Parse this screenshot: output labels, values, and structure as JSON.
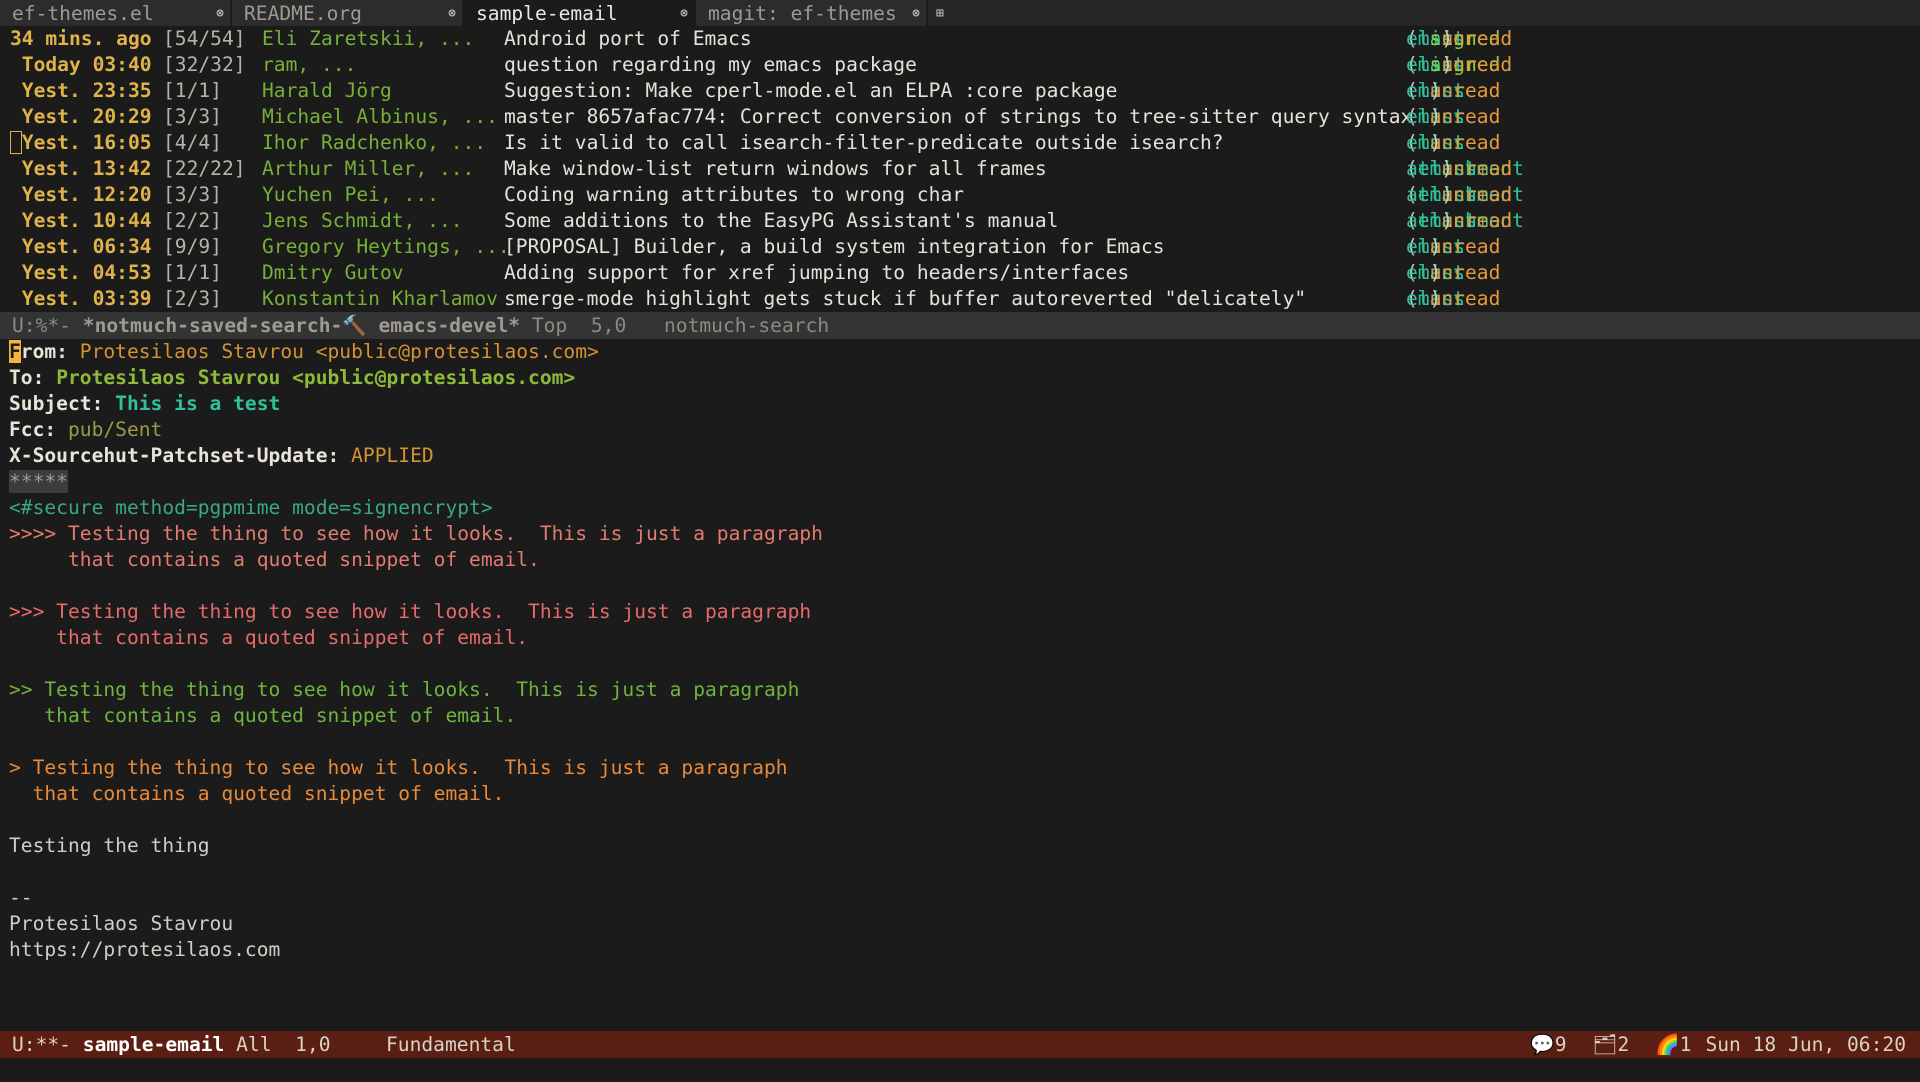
{
  "tabs": [
    {
      "label": "ef-themes.el",
      "active": false
    },
    {
      "label": "README.org",
      "active": false
    },
    {
      "label": "sample-email",
      "active": true
    },
    {
      "label": "magit: ef-themes",
      "active": false
    }
  ],
  "tab_close_glyph": "⊗",
  "tab_add_glyph": "⊞",
  "search_results": [
    {
      "date": "34 mins. ago",
      "count": "[54/54]",
      "authors": "Eli Zaretskii, ...",
      "subject": "Android port of Emacs",
      "tags": [
        "emacs",
        "list",
        "signed",
        "unread"
      ]
    },
    {
      "date": " Today 03:40",
      "count": "[32/32]",
      "authors": "ram, ...",
      "subject": "question regarding my emacs package",
      "tags": [
        "emacs",
        "list",
        "signed",
        "unread"
      ]
    },
    {
      "date": " Yest. 23:35",
      "count": "[1/1]",
      "authors": "Harald Jörg",
      "subject": "Suggestion: Make cperl-mode.el an ELPA :core package",
      "tags": [
        "emacs",
        "list",
        "unread"
      ]
    },
    {
      "date": " Yest. 20:29",
      "count": "[3/3]",
      "authors": "Michael Albinus, ...",
      "subject": "master 8657afac774: Correct conversion of strings to tree-sitter query syntax",
      "tags": [
        "emacs",
        "list",
        "unread"
      ]
    },
    {
      "date": " Yest. 16:05",
      "count": "[4/4]",
      "authors": "Ihor Radchenko, ...",
      "subject": "Is it valid to call isearch-filter-predicate outside isearch?",
      "tags": [
        "emacs",
        "list",
        "unread"
      ]
    },
    {
      "date": " Yest. 13:42",
      "count": "[22/22]",
      "authors": "Arthur Miller, ...",
      "subject": "Make window-list return windows for all frames",
      "tags": [
        "attachment",
        "emacs",
        "list",
        "unread"
      ]
    },
    {
      "date": " Yest. 12:20",
      "count": "[3/3]",
      "authors": "Yuchen Pei, ...",
      "subject": "Coding warning attributes to wrong char",
      "tags": [
        "attachment",
        "emacs",
        "list",
        "unread"
      ]
    },
    {
      "date": " Yest. 10:44",
      "count": "[2/2]",
      "authors": "Jens Schmidt, ...",
      "subject": "Some additions to the EasyPG Assistant's manual",
      "tags": [
        "attachment",
        "emacs",
        "list",
        "unread"
      ]
    },
    {
      "date": " Yest. 06:34",
      "count": "[9/9]",
      "authors": "Gregory Heytings, ...",
      "subject": "[PROPOSAL] Builder, a build system integration for Emacs",
      "tags": [
        "emacs",
        "list",
        "unread"
      ]
    },
    {
      "date": " Yest. 04:53",
      "count": "[1/1]",
      "authors": "Dmitry Gutov",
      "subject": "Adding support for xref jumping to headers/interfaces",
      "tags": [
        "emacs",
        "list",
        "unread"
      ]
    },
    {
      "date": " Yest. 03:39",
      "count": "[2/3]",
      "authors": "Konstantin Kharlamov",
      "subject": "smerge-mode highlight gets stuck if buffer autoreverted \"delicately\"",
      "tags": [
        "emacs",
        "list",
        "unread"
      ]
    }
  ],
  "modeline_top": {
    "status": "U:%*- ",
    "buffer": "*notmuch-saved-search-",
    "icon": "🔨",
    "buffer_rest": " emacs-devel*",
    "position": " Top  5,0",
    "mode": "notmuch-search"
  },
  "message": {
    "from_key": "From:",
    "from_value": "Protesilaos Stavrou <public@protesilaos.com>",
    "to_key": "To:",
    "to_value": "Protesilaos Stavrou <public@protesilaos.com>",
    "subject_key": "Subject:",
    "subject_value": "This is a test",
    "fcc_key": "Fcc:",
    "fcc_value": "pub/Sent",
    "patchset_key": "X-Sourcehut-Patchset-Update:",
    "patchset_value": "APPLIED",
    "separator": "*****",
    "secure_tag": "<#secure method=pgpmime mode=signencrypt>",
    "quote4": [
      ">>>> Testing the thing to see how it looks.  This is just a paragraph",
      "     that contains a quoted snippet of email."
    ],
    "quote3": [
      ">>> Testing the thing to see how it looks.  This is just a paragraph",
      "    that contains a quoted snippet of email."
    ],
    "quote2": [
      ">> Testing the thing to see how it looks.  This is just a paragraph",
      "   that contains a quoted snippet of email."
    ],
    "quote1": [
      "> Testing the thing to see how it looks.  This is just a paragraph",
      "  that contains a quoted snippet of email."
    ],
    "body": "Testing the thing",
    "sig_dash": "--",
    "sig_name": "Protesilaos Stavrou",
    "sig_url": "https://protesilaos.com"
  },
  "modeline_bottom": {
    "status": "U:**- ",
    "buffer": "sample-email",
    "position": " All  1,0",
    "mode": "Fundamental",
    "notifications_icon": "💬",
    "notifications_count": "9",
    "folder_icon": "🗂",
    "folder_count": "2",
    "rainbow_icon": "🌈",
    "rainbow_count": "1",
    "datetime": "Sun 18 Jun, 06:20"
  },
  "colors": {
    "background": "#1b1b1b",
    "modeline_active": "#5a1e12",
    "modeline_inactive": "#343434",
    "tag_green": "#2fc29a",
    "tag_unread": "#e39a3c",
    "date_yellow": "#e0b24a"
  }
}
